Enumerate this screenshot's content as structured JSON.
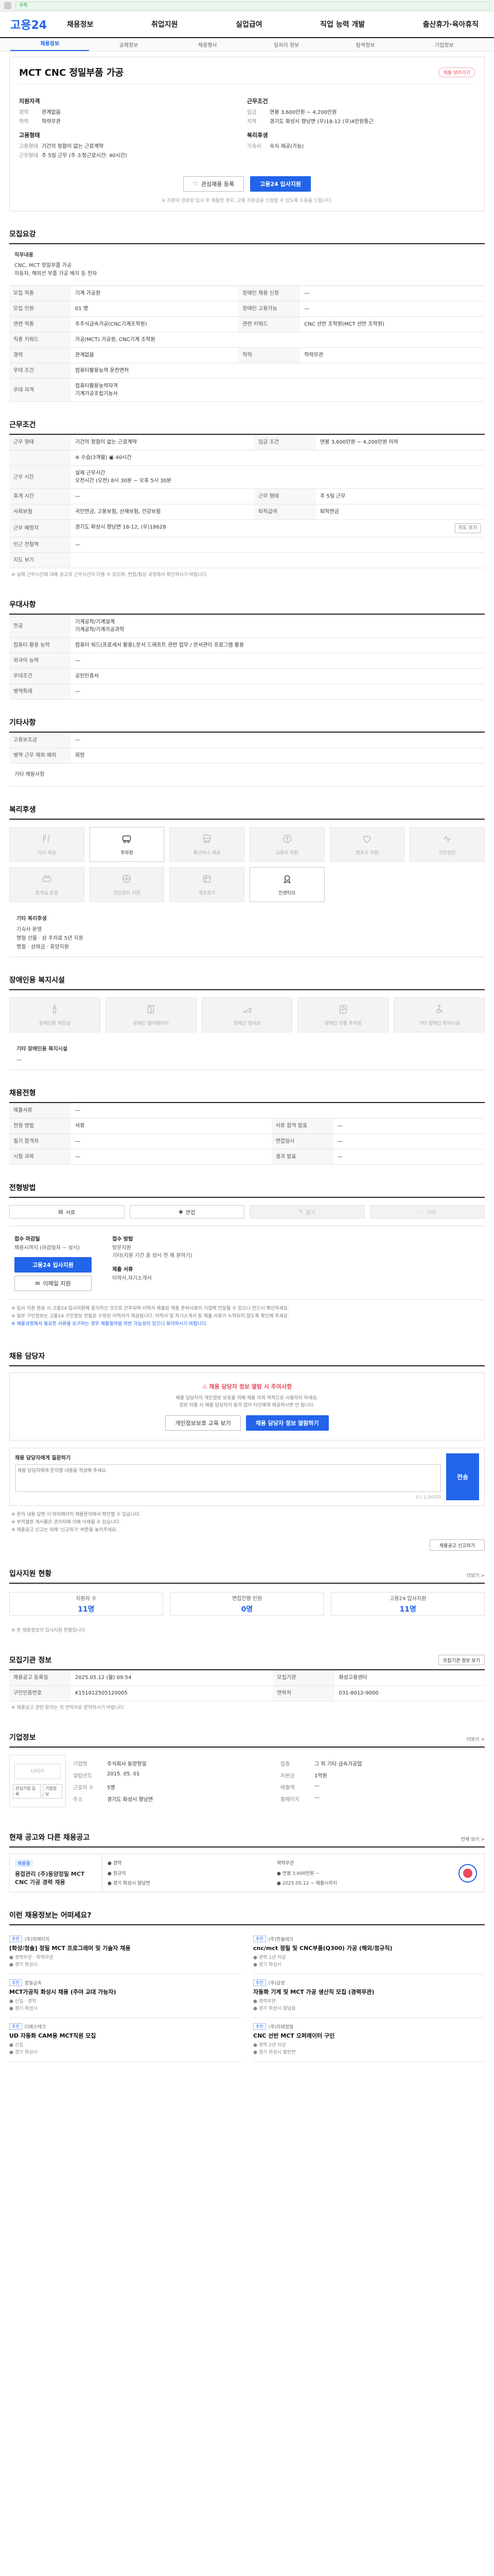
{
  "browser": {
    "url": "구직"
  },
  "header": {
    "logo": "고용24",
    "menu": [
      "채용정보",
      "취업지원",
      "실업급여",
      "직업 능력 개발",
      "출산휴가·육아휴직"
    ]
  },
  "subnav": [
    "채용정보",
    "공채정보",
    "채용행사",
    "일자리 정보",
    "탐색정보",
    "기업정보"
  ],
  "job": {
    "title": "MCT CNC 정밀부품 가공",
    "badge": "채용 보러가기",
    "company_group": "지원자격",
    "left": [
      {
        "k": "경력",
        "v": "관계없음"
      },
      {
        "k": "학력",
        "v": "학력무관"
      }
    ],
    "employment_group": "고용형태",
    "employment": [
      {
        "k": "고용형태",
        "v": "기간의 정함이 없는 근로계약"
      },
      {
        "k": "근무형태",
        "v": "주 5일 근무 (주 소정근로시간: 40시간)"
      }
    ],
    "cond_group": "근무조건",
    "right": [
      {
        "k": "임금",
        "v": "연봉 3,600만원 ~ 4,200만원"
      },
      {
        "k": "지역",
        "v": "경기도 화성시 향남면 (우)18-12 (우)4만원통근"
      }
    ],
    "welfare_group": "복리후생",
    "welfare": [
      {
        "k": "기숙사",
        "v": "숙식 제공(가능)"
      }
    ],
    "btn_save": "관심채용 등록",
    "btn_apply": "고용24 입사지원",
    "note": "※ 지원이 완료된 입사 후 채용한 경우, 고용 지원금을 신청할 수 있도록 도움을 드립니다."
  },
  "recruit": {
    "title": "모집요강",
    "desc_label": "직무내용",
    "desc": "CNC, MCT 정밀부품 가공\n자동차, 해외선 부품 가공 배치 등 전자",
    "rows": [
      {
        "th": "모집 직종",
        "v": "기계 가공원",
        "th2": "장애인 채용 신청",
        "v2": "—"
      },
      {
        "th": "모집 인원",
        "v": "01 명",
        "th2": "장애인 고용가능",
        "v2": "—"
      },
      {
        "th": "관련 직종",
        "v": "주주식금속가공(CNC기계조작원)",
        "th2": "관련 키워드",
        "v2": "CNC 선반 조작원(MCT 선반 조작원)"
      },
      {
        "th": "직종 키워드",
        "v": "가공(MCT) 가공원, CNC기계 조작원",
        "th2": "",
        "v2": ""
      },
      {
        "th": "경력",
        "v": "관계없음",
        "th2": "학력",
        "v2": "학력무관"
      },
      {
        "th": "우대 조건",
        "v": "컴퓨터활용능력 운전면허",
        "th2": "",
        "v2": ""
      },
      {
        "th": "우대 자격",
        "v": "컴퓨터활용능력자격\n기계가공조립기능사",
        "th2": "",
        "v2": ""
      }
    ]
  },
  "condition": {
    "title": "근무조건",
    "rows": [
      {
        "th": "근무 형태",
        "v": "기간의 정함이 없는 근로계약",
        "th2": "임금 조건",
        "v2": "연봉 3,600만원 ~ 4,200만원 이하"
      },
      {
        "th": "",
        "v": "※ 수습(3개월) ▣ 40시간",
        "th2": "",
        "v2": ""
      },
      {
        "th": "근무 시간",
        "v": "실제 근무시간\n오전시간 (오전) 8시 30분 ~ 오후 5시 30분",
        "th2": "",
        "v2": ""
      },
      {
        "th": "휴게 시간",
        "v": "—",
        "th2": "근무 형태",
        "v2": "주 5일 근무"
      },
      {
        "th": "사회보험",
        "v": "국민연금, 고용보험, 산재보험, 건강보험",
        "th2": "퇴직급여",
        "v2": "퇴직연금"
      },
      {
        "th": "근무 예정지",
        "v": "경기도 화성시 향남면 18-12, (우)18628",
        "th2": "",
        "v2": ""
      },
      {
        "th": "인근 전철역",
        "v": "—",
        "th2": "",
        "v2": ""
      },
      {
        "th": "지도 보기",
        "v": "",
        "th2": "",
        "v2": ""
      }
    ],
    "map_btn": "지도 보기",
    "note": "※ 실제 근무시간에 대해 공고의 근무시간이 다를 수 있으며, 면접/협상 과정에서 확인하시기 바랍니다."
  },
  "preference": {
    "title": "우대사항",
    "rows": [
      {
        "th": "전공",
        "v": "기계공학/기계설계\n기계공학/기계가공과학"
      },
      {
        "th": "컴퓨터 활용 능력",
        "v": "컴퓨터 워드(프로세서 활용),문서 드래프트 관련 업무 / 문서관리 프로그램 활용"
      },
      {
        "th": "외국어 능력",
        "v": "—"
      },
      {
        "th": "우대조건",
        "v": "공인인증서"
      },
      {
        "th": "병역특례",
        "v": "—"
      }
    ]
  },
  "etc": {
    "title": "기타사항",
    "rows": [
      {
        "th": "고용보조금",
        "v": "—"
      },
      {
        "th": "병역 근무 제외 예외",
        "v": "희망"
      }
    ],
    "extra": "기타 채용사항"
  },
  "welfare": {
    "title": "복리후생",
    "items": [
      {
        "label": "식사 제공",
        "on": false
      },
      {
        "label": "주차장",
        "on": true
      },
      {
        "label": "통근버스 제공",
        "on": false
      },
      {
        "label": "교통비 지원",
        "on": false
      },
      {
        "label": "경조사 지원",
        "on": false
      },
      {
        "label": "건강검진",
        "on": false
      },
      {
        "label": "휴게실 운영",
        "on": false
      },
      {
        "label": "건강관리 지원",
        "on": false
      },
      {
        "label": "경조휴가",
        "on": false
      },
      {
        "label": "인센티브",
        "on": true
      }
    ],
    "text_title": "기타 복리후생",
    "text": "기숙사 운영\n명절 선물 · 상 주차료 5년 지원\n명절 · 상여금 · 휴양지원"
  },
  "facility": {
    "title": "장애인용 복지시설",
    "items": [
      "장애인용 화장실",
      "장애인 엘리베이터",
      "장애인 경사로",
      "장애인 전용 주차장",
      "기타 장애인 편의시설"
    ],
    "text_title": "기타 장애인용 복지시설",
    "text": "—"
  },
  "process": {
    "title": "채용전형",
    "rows": [
      {
        "th": "제출서류",
        "v": "—",
        "th2": "",
        "v2": ""
      },
      {
        "th": "전형 방법",
        "v": "서류",
        "th2": "서류 합격 발표",
        "v2": "—"
      },
      {
        "th": "필기 합격자",
        "v": "—",
        "th2": "면접일시",
        "v2": "—"
      },
      {
        "th": "시험 과목",
        "v": "—",
        "th2": "결과 발표",
        "v2": "—"
      }
    ]
  },
  "apply": {
    "title": "전형방법",
    "methods": [
      {
        "label": "서류",
        "on": true
      },
      {
        "label": "면접",
        "on": true
      },
      {
        "label": "필기",
        "on": false
      },
      {
        "label": "기타",
        "on": false
      }
    ],
    "period_label": "접수 마감일",
    "period": "채용시까지 (마감일자 ~ 상시)",
    "apply_btn": "고용24 입사지원",
    "email_btn": "이메일 지원",
    "method_label": "접수 방법",
    "method": "방문지원\n기타(지원 기간 중 상시 전 제 원하기)",
    "doc_label": "제출 서류",
    "doc": "이력서,자기소개서",
    "caution": "※ 입사 지원 완료 시 고용24 입사지원에 동의하신 것으로 간주되며 이력서 제출된 채용 준비사항이 기업에 전달될 수 있으니 반드시 확인하세요.",
    "caution2": "※ 일부 구인정보는 고용24 구인정보 전달로 수정된 이력서가 제공됩니다. 이력서 및 자기소개서 등 제출 서류가 누락되지 않도록 확인해 주세요.",
    "caution3": "※ 채용과정에서 필요한 서류를 요구하는 경우 채용절차법 위반 가능성이 있으니 유의하시기 바랍니다."
  },
  "manager": {
    "title": "채용 담당자",
    "warn": "채용 담당자 정보 열람 시 주의사항",
    "desc": "채용 담당자의 개인정보 보호를 위해 채용 이외 목적으로 사용하지 마세요.\n정보 이용 시 채용 담당자의 동의 없이 타인에게 제공하시면 안 됩니다.",
    "btn1": "개인정보보호 교육 보기",
    "btn2": "채용 담당자 정보 열람하기",
    "inquiry_label": "채용 담당자에게 질문하기",
    "placeholder": "채용 담당자에게 문의할 내용을 작성해 주세요.",
    "count": "0 / 1,000자",
    "send": "전송",
    "notes": [
      "※ 문의 내용 답변 시 마이페이지 채용문의에서 확인할 수 있습니다.",
      "※ 부적절한 게시물은 관리자에 의해 삭제될 수 있습니다.",
      "※ 채용공고 신고는 아래 '신고하기' 버튼을 눌러주세요."
    ],
    "report_btn": "채용공고 신고하기"
  },
  "stats": {
    "title": "입사지원 현황",
    "more": "더보기 >",
    "items": [
      {
        "l": "지원자 수",
        "n": "11명"
      },
      {
        "l": "면접진행 인원",
        "n": "0명"
      },
      {
        "l": "고용24 입사지원",
        "n": "11명"
      }
    ],
    "note": "※ 본 채용정보의 입사지원 현황입니다."
  },
  "registration": {
    "title": "모집기관 정보",
    "btn": "모집기관 정보 보기",
    "rows": [
      {
        "th": "채용공고 등록일",
        "v": "2025.05.12 (월) 09:54",
        "th2": "모집기관",
        "v2": "화성고용센터"
      },
      {
        "th": "구인인증번호",
        "v": "K151012505120005",
        "th2": "연락처",
        "v2": "031-8012-9000"
      }
    ],
    "note": "※ 채용공고 관련 문의는 위 연락처로 문의하시기 바랍니다."
  },
  "company": {
    "title": "기업정보",
    "more": "더보기 >",
    "logo_ph": "LOGO",
    "b1": "관심기업 등록",
    "b2": "기업정보",
    "info": [
      {
        "k": "기업명",
        "v": "주식회사 동양정밀"
      },
      {
        "k": "업종",
        "v": "그 외 기타 금속가공업"
      },
      {
        "k": "설립년도",
        "v": "2015. 05. 01"
      },
      {
        "k": "자본금",
        "v": "1억원"
      },
      {
        "k": "근로자 수",
        "v": "5명"
      },
      {
        "k": "매출액",
        "v": "—"
      },
      {
        "k": "주소",
        "v": "경기도 화성시 향남면"
      },
      {
        "k": "홈페이지",
        "v": "—"
      }
    ]
  },
  "other": {
    "title": "현재 공고와 다른 채용공고",
    "more": "전체 보기 >",
    "tag": "채용중",
    "ttl": "용접관리 (주)동양정밀 MCT CNC 가공 경력 채용",
    "cells": [
      "● 경력",
      "학력무관",
      "● 정규직",
      "● 연봉 3,600만원 ~",
      "● 경기 화성시 향남면",
      "● 2025.05.12 ~ 채용시까지"
    ]
  },
  "recommend": {
    "title": "이런 채용정보는 어떠세요?",
    "items": [
      {
        "badge": "추천",
        "company": "(주)피에이치",
        "title": "[화성/청솔] 정밀 MCT 프로그래머 및 기술자 채용",
        "meta": "● 경력무관 · 학력무관\n● 경기 화성시"
      },
      {
        "badge": "추천",
        "company": "(주)한솔테크",
        "title": "cnc/mct 정밀 및 CNC부품(Q300) 가공 (해외/정규직)",
        "meta": "● 경력 1년 이상\n● 경기 화성시"
      },
      {
        "badge": "추천",
        "company": "정밀금속",
        "title": "MCT가공직 화성시 채용 (주야 교대 가능자)",
        "meta": "● 신입 · 경력\n● 경기 화성시"
      },
      {
        "badge": "추천",
        "company": "(주)금양",
        "title": "자동화 기계 및 MCT 가공 생산직 모집 (경력무관)",
        "meta": "● 경력무관\n● 경기 화성시 향남읍"
      },
      {
        "badge": "추천",
        "company": "디에스테크",
        "title": "UD 자동화 CAM용 MCT직원 모집",
        "meta": "● 신입\n● 경기 화성시"
      },
      {
        "badge": "추천",
        "company": "(주)미래정밀",
        "title": "CNC 선반 MCT 오퍼레이터 구인",
        "meta": "● 경력 2년 이상\n● 경기 화성시 팔탄면"
      }
    ]
  }
}
